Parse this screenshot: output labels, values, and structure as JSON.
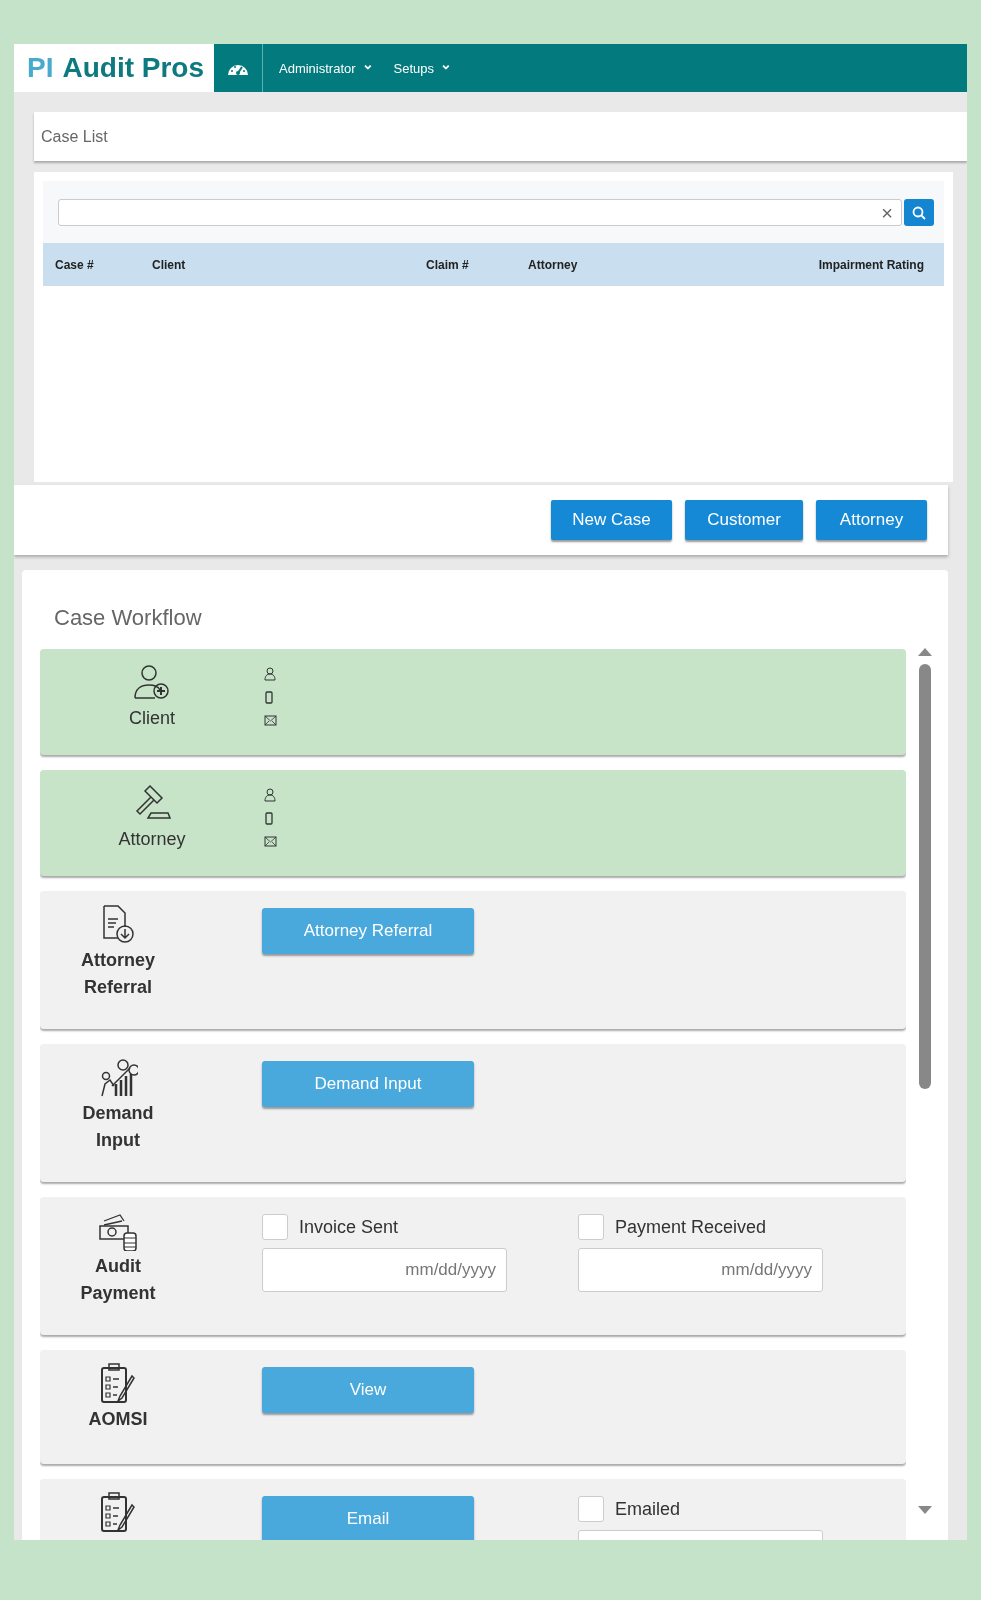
{
  "header": {
    "logo_prefix": "PI",
    "logo_name": "Audit Pros",
    "menus": [
      {
        "label": "Administrator",
        "caret": "⌄"
      },
      {
        "label": "Setups",
        "caret": "⌄"
      }
    ]
  },
  "case_list": {
    "title": "Case List",
    "search": {
      "clear": "×"
    },
    "columns": [
      "Case #",
      "Client",
      "Claim #",
      "Attorney",
      "Impairment Rating"
    ],
    "buttons": [
      "New Case",
      "Customer",
      "Attorney"
    ]
  },
  "workflow": {
    "title": "Case Workflow",
    "rows": [
      {
        "label": "Client",
        "completed": true,
        "kind": "contact"
      },
      {
        "label": "Attorney",
        "completed": true,
        "kind": "contact"
      },
      {
        "label": "Attorney Referral",
        "completed": false,
        "kind": "actions",
        "controls": [
          {
            "kind": "button",
            "label": "Attorney Referral"
          }
        ]
      },
      {
        "label": "Demand Input",
        "completed": false,
        "kind": "actions",
        "controls": [
          {
            "kind": "button",
            "label": "Demand Input"
          }
        ]
      },
      {
        "label": "Audit Payment",
        "completed": false,
        "kind": "actions",
        "controls": [
          {
            "kind": "check",
            "label": "Invoice Sent",
            "checked": false,
            "date_placeholder": "mm/dd/yyyy"
          },
          {
            "kind": "check",
            "label": "Payment Received",
            "checked": false,
            "date_placeholder": "mm/dd/yyyy"
          }
        ]
      },
      {
        "label": "AOMSI",
        "completed": false,
        "kind": "actions",
        "controls": [
          {
            "kind": "button",
            "label": "View"
          }
        ]
      },
      {
        "completed": false,
        "kind": "actions",
        "controls": [
          {
            "kind": "button",
            "label": "Email"
          },
          {
            "kind": "check",
            "label": "Emailed",
            "checked": false,
            "date_field": true
          }
        ]
      }
    ]
  }
}
